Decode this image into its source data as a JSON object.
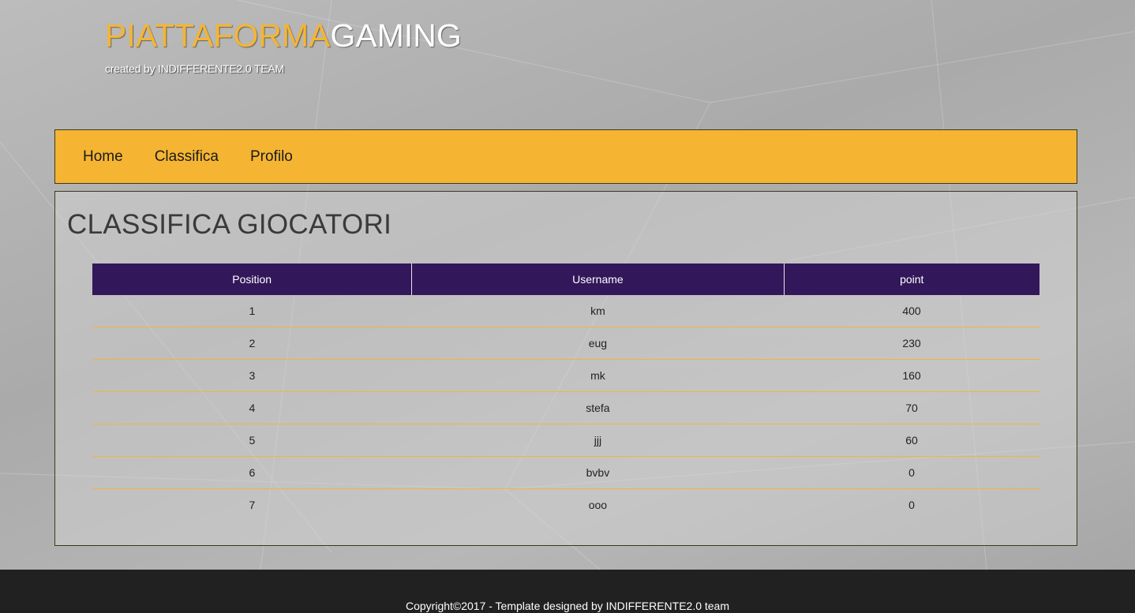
{
  "header": {
    "brand_part1": "PIATTAFORMA",
    "brand_part2": "GAMING",
    "tagline": "created by INDIFFERENTE2.0 TEAM"
  },
  "nav": {
    "items": [
      {
        "label": "Home"
      },
      {
        "label": "Classifica"
      },
      {
        "label": "Profilo"
      }
    ]
  },
  "main": {
    "title": "CLASSIFICA GIOCATORI",
    "table": {
      "columns": [
        "Position",
        "Username",
        "point"
      ],
      "rows": [
        [
          "1",
          "km",
          "400"
        ],
        [
          "2",
          "eug",
          "230"
        ],
        [
          "3",
          "mk",
          "160"
        ],
        [
          "4",
          "stefa",
          "70"
        ],
        [
          "5",
          "jjj",
          "60"
        ],
        [
          "6",
          "bvbv",
          "0"
        ],
        [
          "7",
          "ooo",
          "0"
        ]
      ]
    }
  },
  "footer": {
    "text": "Copyright©2017 - Template designed by INDIFFERENTE2.0 team"
  },
  "colors": {
    "accent": "#f5b532",
    "table_header": "#32175a",
    "footer_bg": "#212121"
  }
}
